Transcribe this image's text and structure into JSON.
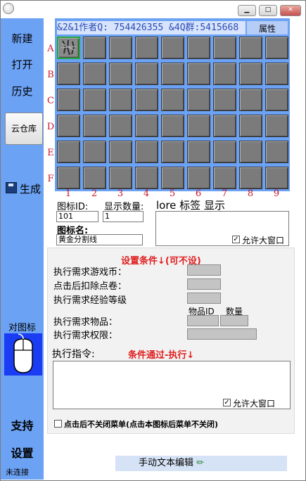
{
  "window": {
    "minimize_glyph": "▁",
    "maximize_glyph": "□",
    "close_glyph": "✕"
  },
  "sidebar": {
    "new_label": "新建",
    "open_label": "打开",
    "history_label": "历史",
    "cloud_label": "云仓库",
    "generate_label": "生成",
    "mouse_caption": "对图标",
    "support_label": "支持",
    "settings_label": "设置",
    "status_label": "未连接"
  },
  "grid": {
    "header_text": "&2&1作者Q: 754426355 &4Q群:5415668",
    "property_tab": "属性",
    "rows": [
      "A",
      "B",
      "C",
      "D",
      "E",
      "F"
    ],
    "columns": [
      "1",
      "2",
      "3",
      "4",
      "5",
      "6",
      "7",
      "8",
      "9"
    ],
    "selected_cell": "A1"
  },
  "icon_fields": {
    "icon_id_label": "图标ID:",
    "icon_id_value": "101",
    "display_count_label": "显示数量:",
    "display_count_value": "1",
    "lore_label": "lore 标签 显示",
    "icon_name_label": "图标名:",
    "icon_name_value": "黄金分割线",
    "allow_large_window_1": "允许大窗口",
    "allow_large_window_1_checked": true
  },
  "conditions": {
    "title": "设置条件↓(可不设)",
    "game_currency_label": "执行需求游戏币：",
    "deduct_points_label": "点击后扣除点卷：",
    "exp_level_label": "执行需求经验等级",
    "item_id_header": "物品ID",
    "quantity_header": "数量",
    "items_label": "执行需求物品：",
    "permission_label": "执行需求权限：",
    "command_label": "执行指令:",
    "pass_title": "条件通过-执行↓",
    "allow_large_window_2": "允许大窗口",
    "allow_large_window_2_checked": true,
    "keep_menu_label": "点击后不关闭菜单(点击本图标后菜单不关闭)",
    "keep_menu_checked": false
  },
  "footer": {
    "manual_edit_label": "手动文本编辑",
    "pencil_glyph": "✏"
  }
}
